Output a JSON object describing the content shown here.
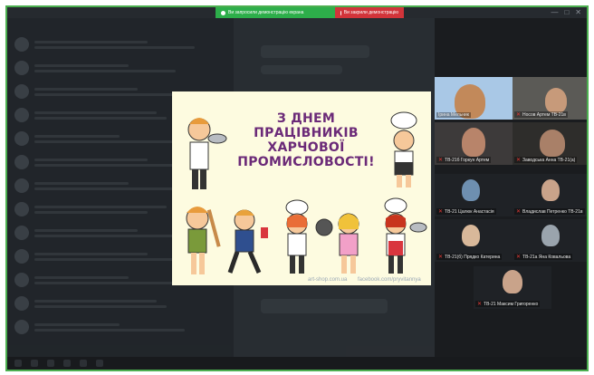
{
  "share_bar": {
    "left_label": "Ви запросили демонстрацію екрана",
    "right_label": "Ви закрили демонстрацію"
  },
  "window_controls": [
    "—",
    "□",
    "✕"
  ],
  "slide": {
    "title_lines": [
      "З ДНЕМ",
      "ПРАЦІВНИКІВ",
      "ХАРЧОВОЇ",
      "ПРОМИСЛОВОСТІ!"
    ],
    "credit_1": "art-shop.com.ua",
    "credit_2": "facebook.com/pryvitannya"
  },
  "participants": [
    {
      "name": "Ірина Мельник"
    },
    {
      "name": "Носов Артем ТВ-21в"
    },
    {
      "name": "ТВ-21б Горкун Артем"
    },
    {
      "name": "Заводська Анна ТВ-21(а)"
    },
    {
      "name": "ТВ-21 Цалюк Анастасія"
    },
    {
      "name": "Владислав Петренко ТВ-21в"
    },
    {
      "name": "ТВ-21(б) Прядко Катерина"
    },
    {
      "name": "ТВ-21а Яна Ковальова"
    },
    {
      "name": "ТВ-21 Максим Григоренко"
    }
  ],
  "colors": {
    "frame_border": "#4caf50",
    "share_green": "#2dae4a",
    "share_red": "#d2343a",
    "title_text": "#6b2a78"
  }
}
